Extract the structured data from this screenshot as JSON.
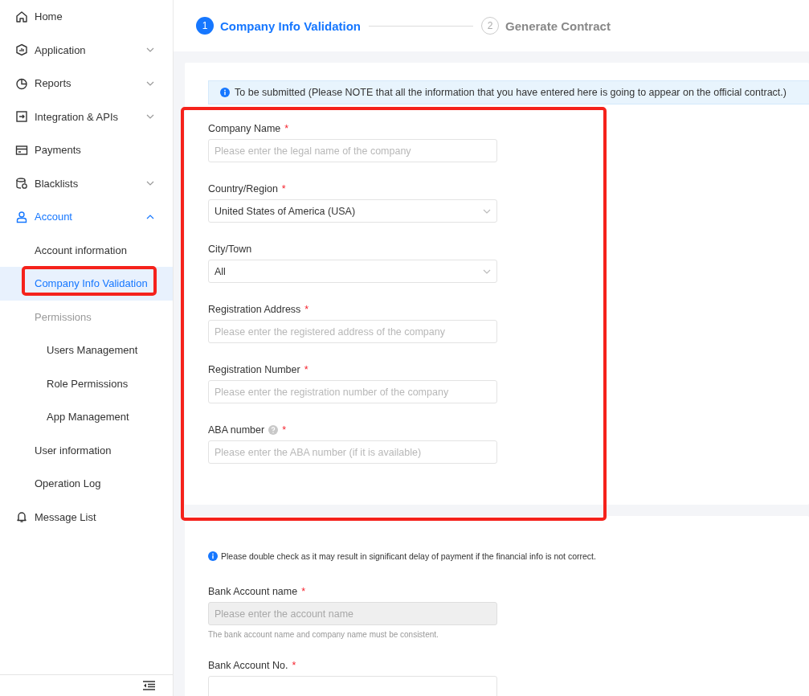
{
  "sidebar": {
    "items": [
      {
        "label": "Home",
        "selected": false
      },
      {
        "label": "Application",
        "expanded": false,
        "selected": false
      },
      {
        "label": "Reports",
        "expanded": false,
        "selected": false
      },
      {
        "label": "Integration & APIs",
        "expanded": false,
        "selected": false
      },
      {
        "label": "Payments",
        "selected": false
      },
      {
        "label": "Blacklists",
        "expanded": false,
        "selected": false
      },
      {
        "label": "Account",
        "expanded": true,
        "selected": true,
        "children": [
          {
            "label": "Account information",
            "kind": "item",
            "selected": false
          },
          {
            "label": "Company Info Validation",
            "kind": "item",
            "selected": true
          },
          {
            "label": "Permissions",
            "kind": "group",
            "children": [
              {
                "label": "Users Management",
                "kind": "item",
                "selected": false
              },
              {
                "label": "Role Permissions",
                "kind": "item",
                "selected": false
              },
              {
                "label": "App Management",
                "kind": "item",
                "selected": false
              }
            ]
          },
          {
            "label": "User information",
            "kind": "item",
            "selected": false
          },
          {
            "label": "Operation Log",
            "kind": "item",
            "selected": false
          }
        ]
      },
      {
        "label": "Message List",
        "selected": false
      }
    ]
  },
  "steps": [
    {
      "number": "1",
      "label": "Company Info Validation",
      "selected": true
    },
    {
      "number": "2",
      "label": "Generate Contract",
      "selected": false
    }
  ],
  "cards": [
    {
      "notice": {
        "kind": "banner",
        "text": "To be submitted (Please NOTE that all the information that you have entered here is going to appear on the official contract.)"
      },
      "fields": [
        {
          "label": "Company Name",
          "required_mark": "*",
          "kind": "input",
          "placeholder": "Please enter the legal name of the company",
          "disabled": false
        },
        {
          "label": "Country/Region",
          "required_mark": "*",
          "kind": "select",
          "value": "United States of America (USA)"
        },
        {
          "label": "City/Town",
          "kind": "select",
          "value": "All"
        },
        {
          "label": "Registration Address",
          "required_mark": "*",
          "kind": "input",
          "placeholder": "Please enter the registered address of the company",
          "disabled": false
        },
        {
          "label": "Registration Number",
          "required_mark": "*",
          "kind": "input",
          "placeholder": "Please enter the registration number of the company",
          "disabled": false
        },
        {
          "label": "ABA number",
          "required_mark": "*",
          "help": true,
          "kind": "input",
          "placeholder": "Please enter the ABA number (if it is available)",
          "disabled": false
        }
      ]
    },
    {
      "notice": {
        "kind": "plain",
        "text": "Please double check as it may result in significant delay of payment if the financial info is not correct."
      },
      "fields": [
        {
          "label": "Bank Account name",
          "required_mark": "*",
          "kind": "input",
          "placeholder": "Please enter the account name",
          "disabled": true,
          "hint": "The bank account name and company name must be consistent."
        },
        {
          "label": "Bank Account No.",
          "required_mark": "*",
          "kind": "input",
          "disabled": false
        }
      ]
    }
  ]
}
